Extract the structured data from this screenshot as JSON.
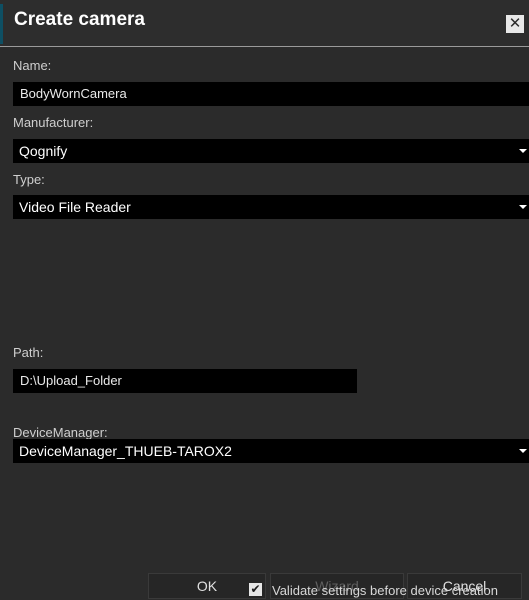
{
  "dialog": {
    "title": "Create camera",
    "close_symbol": "✕"
  },
  "form": {
    "name_label": "Name:",
    "name_value": "BodyWornCamera",
    "manufacturer_label": "Manufacturer:",
    "manufacturer_value": "Qognify",
    "type_label": "Type:",
    "type_value": "Video File Reader",
    "path_label": "Path:",
    "path_value": "D:\\Upload_Folder",
    "device_manager_label": "DeviceManager:",
    "device_manager_value": "DeviceManager_THUEB-TAROX2"
  },
  "buttons": {
    "ok": "OK",
    "wizard": "Wizard",
    "cancel": "Cancel"
  },
  "validate": {
    "checked": true,
    "check_glyph": "✔",
    "label": "Validate settings before device creation"
  }
}
